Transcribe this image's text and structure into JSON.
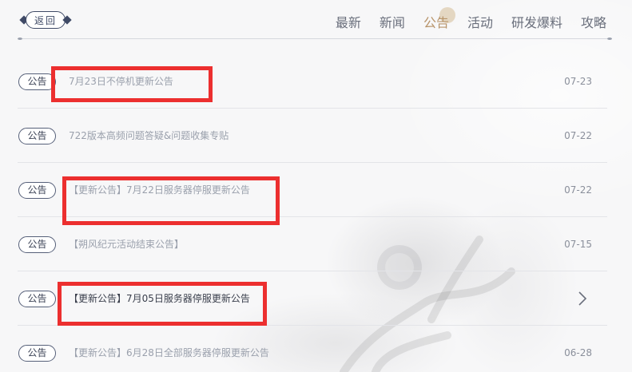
{
  "header": {
    "back_label": "返回",
    "nav": [
      {
        "label": "最新",
        "active": false
      },
      {
        "label": "新闻",
        "active": false
      },
      {
        "label": "公告",
        "active": true
      },
      {
        "label": "活动",
        "active": false
      },
      {
        "label": "研发爆料",
        "active": false
      },
      {
        "label": "攻略",
        "active": false
      }
    ]
  },
  "list": [
    {
      "tag": "公告",
      "title": "7月23日不停机更新公告",
      "date": "07-23",
      "chevron": false
    },
    {
      "tag": "公告",
      "title": "722版本高频问题答疑&问题收集专贴",
      "date": "07-22",
      "chevron": false
    },
    {
      "tag": "公告",
      "title": "【更新公告】7月22日服务器停服更新公告",
      "date": "07-22",
      "chevron": false
    },
    {
      "tag": "公告",
      "title": "【朔风纪元活动结束公告】",
      "date": "07-15",
      "chevron": false
    },
    {
      "tag": "公告",
      "title": "【更新公告】7月05日服务器停服更新公告",
      "date": "",
      "chevron": true
    },
    {
      "tag": "公告",
      "title": "【更新公告】6月28日全部服务器停服更新公告",
      "date": "06-28",
      "chevron": false
    }
  ],
  "colors": {
    "accent": "#b8946a",
    "highlight_box": "#ec2f2f",
    "tag_border": "#566079"
  },
  "icons": {
    "chevron": "chevron-right-icon",
    "back_ornament": "diamond-icon"
  }
}
